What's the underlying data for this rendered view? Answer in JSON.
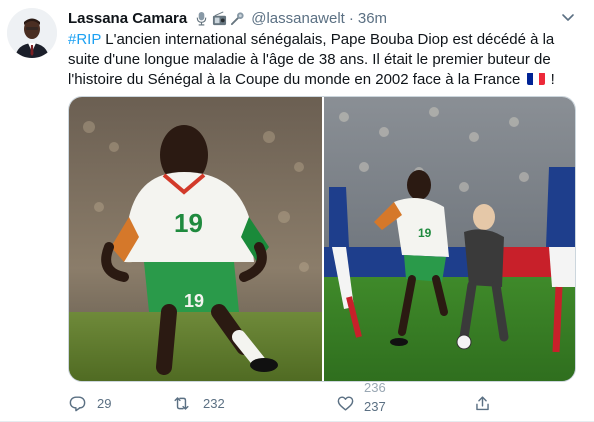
{
  "tweet": {
    "author_name": "Lassana Camara",
    "author_emojis": [
      "studio-microphone-icon",
      "radio-icon",
      "microphone-icon"
    ],
    "handle": "@lassanawelt",
    "separator": "·",
    "time": "36m",
    "hashtag": "#RIP",
    "text_after_hashtag": " L'ancien international sénégalais, Pape Bouba Diop est décédé à la suite d'une longue maladie à l'âge de 38 ans. Il était le premier buteur de l'histoire du Sénégal à la Coupe du monde en 2002 face à la France",
    "flag": "flag-france-icon",
    "text_end": " !"
  },
  "actions": {
    "reply_count": "29",
    "retweet_count": "232",
    "like_count_previous": "236",
    "like_count": "237"
  },
  "colors": {
    "accent": "#1da1f2",
    "secondary_text": "#5b7083",
    "primary_text": "#0f1419"
  }
}
